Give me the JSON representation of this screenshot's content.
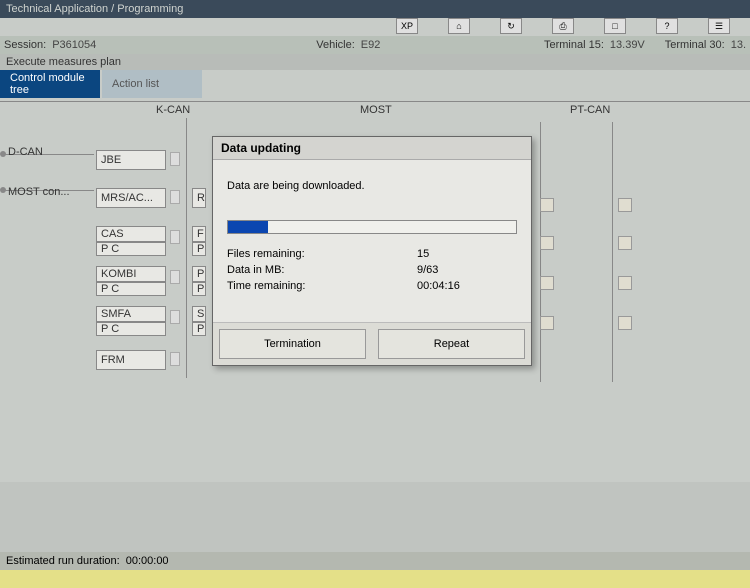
{
  "titlebar": "Technical Application / Programming",
  "toolbar_icons": [
    "XP",
    "⌂",
    "↻",
    "⎙",
    "□",
    "?",
    "☰"
  ],
  "info": {
    "session_label": "Session:",
    "session": "P361054",
    "vehicle_label": "Vehicle:",
    "vehicle": "E92",
    "term15_label": "Terminal 15:",
    "term15": "13.39V",
    "term30_label": "Terminal 30:",
    "term30": "13."
  },
  "subtitle": "Execute measures plan",
  "tabs": {
    "active": "Control module tree",
    "inactive": "Action list"
  },
  "bus": {
    "dcan": "D-CAN",
    "kcan": "K-CAN",
    "most": "MOST",
    "ptcan": "PT-CAN",
    "mostcon": "MOST con..."
  },
  "modules": {
    "jbe": "JBE",
    "mrs": "MRS/AC...",
    "cas": "CAS",
    "cas_sub": "P C",
    "kombi": "KOMBI",
    "kombi_sub": "P C",
    "smfa": "SMFA",
    "smfa_sub": "P C",
    "frm": "FRM",
    "r": "R",
    "f": "F",
    "p": "P",
    "s": "S"
  },
  "dialog": {
    "title": "Data updating",
    "msg": "Data are being downloaded.",
    "labels": {
      "files": "Files remaining:",
      "data": "Data in MB:",
      "time": "Time remaining:"
    },
    "vals": {
      "files": "15",
      "data": "9/63",
      "time": "00:04:16"
    },
    "btn_term": "Termination",
    "btn_repeat": "Repeat"
  },
  "footer": {
    "runtime_label": "Estimated run duration:",
    "runtime": "00:00:00"
  }
}
